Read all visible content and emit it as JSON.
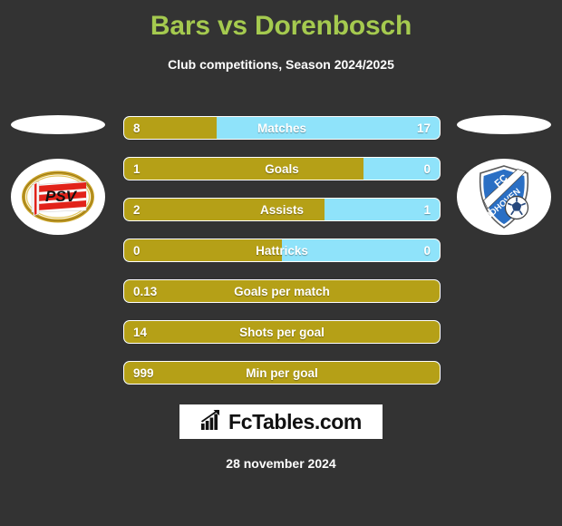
{
  "header": {
    "title": "Bars vs Dorenbosch",
    "subtitle": "Club competitions, Season 2024/2025",
    "title_color": "#a5ca4f"
  },
  "teams": {
    "home": {
      "name": "PSV",
      "crest": "psv-crest-icon"
    },
    "away": {
      "name": "FC Eindhoven",
      "crest": "fc-eindhoven-crest-icon"
    }
  },
  "colors": {
    "background": "#333333",
    "home_bar": "#b5a017",
    "away_bar": "#8fe3fa",
    "accent": "#a5ca4f"
  },
  "stats": [
    {
      "label": "Matches",
      "home": "8",
      "away": "17",
      "home_pct": 29.2,
      "full": false
    },
    {
      "label": "Goals",
      "home": "1",
      "away": "0",
      "home_pct": 76.0,
      "full": false
    },
    {
      "label": "Assists",
      "home": "2",
      "away": "1",
      "home_pct": 63.4,
      "full": false
    },
    {
      "label": "Hattricks",
      "home": "0",
      "away": "0",
      "home_pct": 50.0,
      "full": false
    },
    {
      "label": "Goals per match",
      "home": "0.13",
      "away": "",
      "home_pct": 100,
      "full": true
    },
    {
      "label": "Shots per goal",
      "home": "14",
      "away": "",
      "home_pct": 100,
      "full": true
    },
    {
      "label": "Min per goal",
      "home": "999",
      "away": "",
      "home_pct": 100,
      "full": true
    }
  ],
  "footer": {
    "brand": "FcTables.com",
    "brand_icon": "bar-chart-icon",
    "date": "28 november 2024"
  }
}
